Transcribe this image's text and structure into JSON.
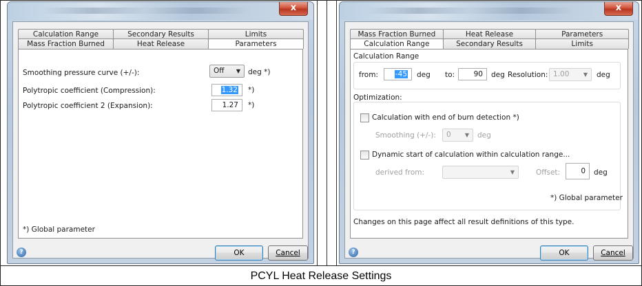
{
  "caption": "PCYL Heat Release Settings",
  "left_dialog": {
    "close_glyph": "x",
    "tabs_back": [
      "Calculation Range",
      "Secondary Results",
      "Limits"
    ],
    "tabs_front": [
      "Mass Fraction Burned",
      "Heat Release",
      "Parameters"
    ],
    "active_tab": "Parameters",
    "smoothing_label": "Smoothing pressure curve (+/-):",
    "smoothing_value": "Off",
    "smoothing_unit": "deg *)",
    "poly_comp_label": "Polytropic coefficient (Compression):",
    "poly_comp_value": "1.32",
    "poly_comp_marker": "*)",
    "poly_exp_label": "Polytropic coefficient 2 (Expansion):",
    "poly_exp_value": "1.27",
    "poly_exp_marker": "*)",
    "global_note": "*) Global parameter",
    "ok_label": "OK",
    "cancel_label": "Cancel"
  },
  "right_dialog": {
    "close_glyph": "x",
    "tabs_back": [
      "Mass Fraction Burned",
      "Heat Release",
      "Parameters"
    ],
    "tabs_front": [
      "Calculation Range",
      "Secondary Results",
      "Limits"
    ],
    "active_tab": "Calculation Range",
    "calc_range_title": "Calculation Range",
    "from_label": "from:",
    "from_value": "-45",
    "from_unit": "deg",
    "to_label": "to:",
    "to_value": "90",
    "to_unit": "deg",
    "resolution_label": "Resolution:",
    "resolution_value": "1.00",
    "resolution_unit": "deg",
    "optimization_title": "Optimization:",
    "eob_label": "Calculation with end of burn detection *)",
    "smoothing_label": "Smoothing (+/-):",
    "smoothing_value": "0",
    "smoothing_unit": "deg",
    "dynamic_label": "Dynamic start of calculation within calculation range...",
    "derived_label": "derived from:",
    "derived_value": "",
    "offset_label": "Offset:",
    "offset_value": "0",
    "offset_unit": "deg",
    "global_note": "*) Global parameter",
    "changes_note": "Changes on this page affect all result definitions of this type.",
    "ok_label": "OK",
    "cancel_label": "Cancel"
  }
}
